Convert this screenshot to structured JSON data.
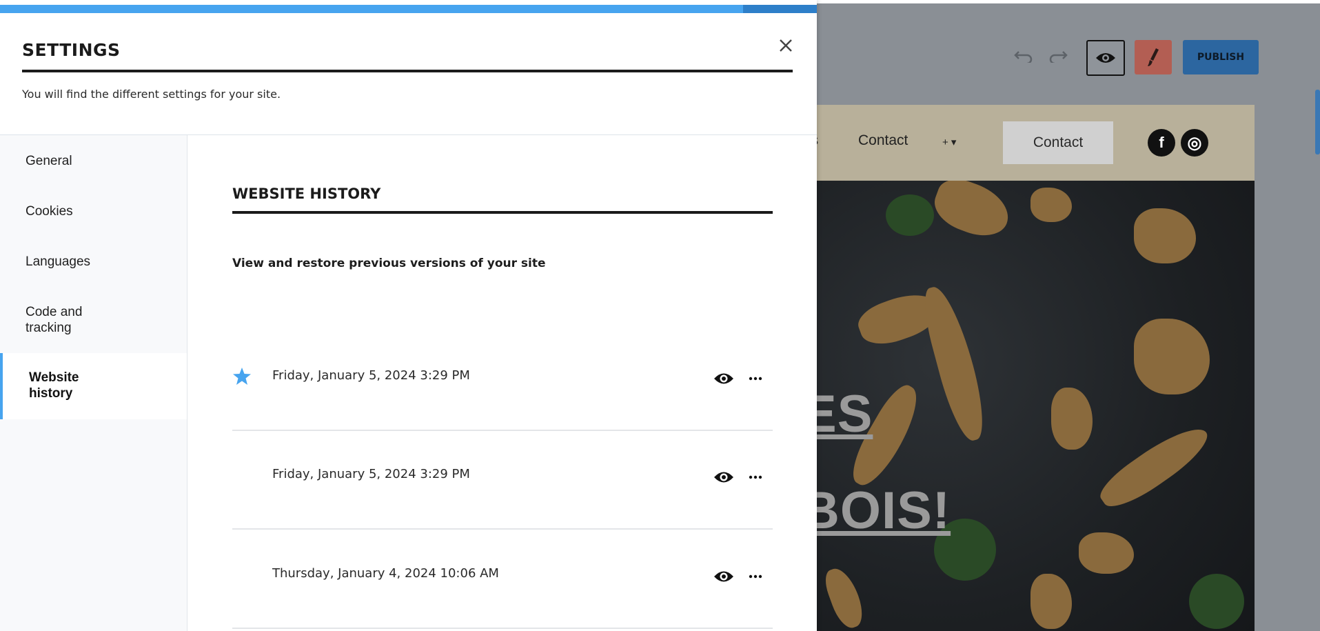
{
  "editor": {
    "nav_partial": "es",
    "nav_contact": "Contact",
    "nav_more": "+ ▾",
    "contact_button": "Contact",
    "social_facebook": "f",
    "social_instagram": "◎",
    "hero_line1": "ES",
    "hero_line2": "BOIS!",
    "toolbar": {
      "undo_icon": "undo-icon",
      "redo_icon": "redo-icon",
      "preview_icon": "eye-icon",
      "design_icon": "brush-icon",
      "publish_label": "PUBLISH"
    },
    "colors": {
      "publish_bg": "#2c66a0",
      "design_bg": "#b35e53",
      "header_bg": "#b8b09a"
    }
  },
  "settings": {
    "progress_percent": 91,
    "title": "SETTINGS",
    "subtitle": "You will find the different settings for your site.",
    "close_icon": "close-icon",
    "accent_color": "#47a4ef",
    "sidebar": [
      {
        "label": "General",
        "active": false
      },
      {
        "label": "Cookies",
        "active": false
      },
      {
        "label": "Languages",
        "active": false
      },
      {
        "label": "Code and tracking",
        "active": false
      },
      {
        "label": "Website history",
        "active": true
      }
    ],
    "section": {
      "title": "WEBSITE HISTORY",
      "description": "View and restore previous versions of your site",
      "versions": [
        {
          "date": "Friday, January 5, 2024 3:29 PM",
          "starred": true
        },
        {
          "date": "Friday, January 5, 2024 3:29 PM",
          "starred": false
        },
        {
          "date": "Thursday, January 4, 2024 10:06 AM",
          "starred": false
        }
      ]
    }
  }
}
